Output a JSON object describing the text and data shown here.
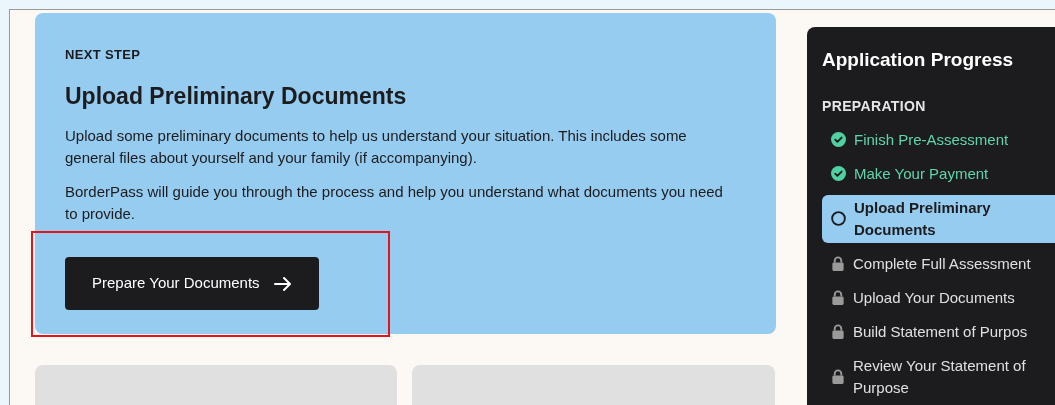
{
  "next_step": {
    "eyebrow": "NEXT STEP",
    "title": "Upload Preliminary Documents",
    "paragraphs": [
      "Upload some preliminary documents to help us understand your situation. This includes some general files about yourself and your family (if accompanying).",
      "BorderPass will guide you through the process and help you understand what documents you need to provide."
    ],
    "button": {
      "label": "Prepare Your Documents",
      "highlighted": true
    }
  },
  "progress": {
    "title": "Application Progress",
    "section": "PREPARATION",
    "steps": [
      {
        "label": "Finish Pre-Assessment",
        "kind": "done",
        "selected": false
      },
      {
        "label": "Make Your Payment",
        "kind": "done",
        "selected": false
      },
      {
        "label": "Upload Preliminary Documents",
        "kind": "current",
        "selected": true
      },
      {
        "label": "Complete Full Assessment",
        "kind": "locked",
        "selected": false
      },
      {
        "label": "Upload Your Documents",
        "kind": "locked",
        "selected": false
      },
      {
        "label": "Build Statement of Purpos",
        "kind": "locked",
        "selected": false
      },
      {
        "label": "Review Your Statement of Purpose",
        "kind": "locked",
        "selected": false
      }
    ]
  }
}
